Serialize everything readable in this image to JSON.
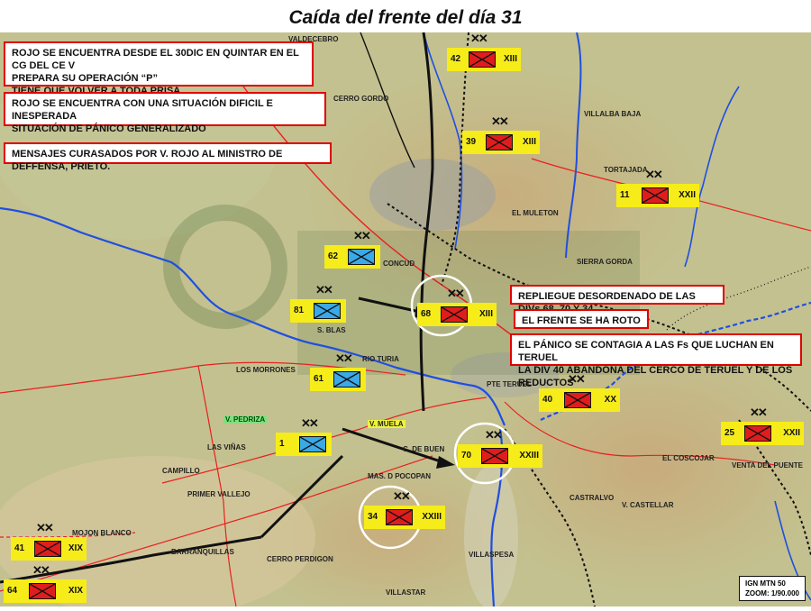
{
  "title": "Caída del frente del día 31",
  "notes": [
    {
      "text": "ROJO SE ENCUENTRA DESDE EL 30DIC EN QUINTAR EN EL CG DEL CE V\nPREPARA SU OPERACIÓN “P”\nTIENE QUE VOLVER A TODA PRISA"
    },
    {
      "text": "ROJO SE ENCUENTRA CON UNA SITUACIÓN  DIFICIL E INESPERADA\nSITUACIÓN DE PÁNICO GENERALIZADO"
    },
    {
      "text": "MENSAJES CURASADOS POR V. ROJO AL MINISTRO DE DEFFENSA, PRIETO."
    },
    {
      "text": "REPLIEGUE DESORDENADO DE LAS DIVs 68, 70 Y 34"
    },
    {
      "text": "EL FRENTE SE HA ROTO"
    },
    {
      "text": "EL PÁNICO SE CONTAGIA  A LAS Fs QUE LUCHAN EN TERUEL\nLA  DIV 40 ABANDONA DEL CERCO DE TERUEL Y DE LOS REDUCTOS"
    }
  ],
  "units": [
    {
      "num": "42",
      "corps": "XIII",
      "side": "red",
      "echelon": "XX"
    },
    {
      "num": "39",
      "corps": "XIII",
      "side": "red",
      "echelon": "XX"
    },
    {
      "num": "11",
      "corps": "XXII",
      "side": "red",
      "echelon": "XX"
    },
    {
      "num": "62",
      "corps": "",
      "side": "blue",
      "echelon": "XX"
    },
    {
      "num": "81",
      "corps": "",
      "side": "blue",
      "echelon": "XX"
    },
    {
      "num": "68",
      "corps": "XIII",
      "side": "red",
      "echelon": "XX"
    },
    {
      "num": "61",
      "corps": "",
      "side": "blue",
      "echelon": "XX"
    },
    {
      "num": "40",
      "corps": "XX",
      "side": "red",
      "echelon": "XX"
    },
    {
      "num": "25",
      "corps": "XXII",
      "side": "red",
      "echelon": "XX"
    },
    {
      "num": "1",
      "corps": "",
      "side": "blue",
      "echelon": "XX"
    },
    {
      "num": "70",
      "corps": "XXIII",
      "side": "red",
      "echelon": "XX"
    },
    {
      "num": "34",
      "corps": "XXIII",
      "side": "red",
      "echelon": "XX"
    },
    {
      "num": "41",
      "corps": "XIX",
      "side": "red",
      "echelon": "XX"
    },
    {
      "num": "64",
      "corps": "XIX",
      "side": "red",
      "echelon": "XX"
    }
  ],
  "places": [
    {
      "text": "CERRO GORDO",
      "style": "green"
    },
    {
      "text": "VALDECEBRO",
      "style": "plain"
    },
    {
      "text": "VILLASPESA",
      "style": "plain"
    },
    {
      "text": "TORTAJADA",
      "style": "plain"
    },
    {
      "text": "EL MULETON",
      "style": "green"
    },
    {
      "text": "SIERRA GORDA",
      "style": "plain"
    },
    {
      "text": "CONCUD",
      "style": "plain"
    },
    {
      "text": "S. BLAS",
      "style": "plain"
    },
    {
      "text": "RIO TURIA",
      "style": "green"
    },
    {
      "text": "PTE TERUEL",
      "style": "plain"
    },
    {
      "text": "V. MUELA",
      "style": "yellow"
    },
    {
      "text": "C. DE BUEN",
      "style": "plain"
    },
    {
      "text": "MAS. D POCOPAN",
      "style": "plain"
    },
    {
      "text": "CASTRALVO",
      "style": "plain"
    },
    {
      "text": "V. CASTELLAR",
      "style": "plain"
    },
    {
      "text": "CAMPILLO",
      "style": "plain"
    },
    {
      "text": "MOJON BLANCO",
      "style": "plain"
    },
    {
      "text": "BARRANQUILLAS",
      "style": "plain"
    },
    {
      "text": "CERRO PERDIGON",
      "style": "plain"
    },
    {
      "text": "VILLASTAR",
      "style": "plain"
    },
    {
      "text": "LAS VIÑAS",
      "style": "plain"
    },
    {
      "text": "V. PEDRIZA",
      "style": "green"
    },
    {
      "text": "PRIMER VALLEJO",
      "style": "plain"
    },
    {
      "text": "LOS MORRONES",
      "style": "plain"
    },
    {
      "text": "VILLALBA BAJA",
      "style": "plain"
    },
    {
      "text": "EL COSCOJAR",
      "style": "plain"
    },
    {
      "text": "VENTA DEL PUENTE",
      "style": "plain"
    }
  ],
  "legend": {
    "text": "IGN MTN 50\nZOOM: 1/90.000"
  },
  "colors": {
    "enemy": "#e01d1d",
    "own": "#3aa9e8",
    "unit_bg": "#f6ec1a",
    "river": "#1f4fe0",
    "front": "#e82020"
  }
}
